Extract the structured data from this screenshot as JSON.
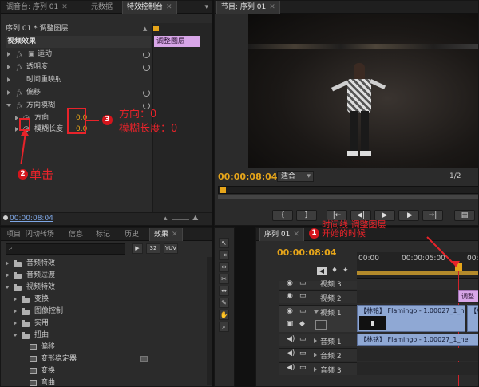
{
  "left_top_panel": {
    "tabs": [
      "调音台: 序列 01",
      "元数据",
      "特效控制台"
    ],
    "sequence_label": "序列 01 * 调整图层",
    "section": "视频效果",
    "effects": [
      "运动",
      "透明度",
      "时间重映射",
      "偏移",
      "方向模糊"
    ],
    "params": [
      {
        "label": "方向",
        "value": "0.0"
      },
      {
        "label": "模糊长度",
        "value": "0.0"
      }
    ],
    "clip_label": "调整图层",
    "timecode": "00:00:08:04"
  },
  "program_monitor": {
    "tab": "节目: 序列 01",
    "timecode": "00:00:08:04",
    "fit": "适合",
    "page": "1/2",
    "buttons": [
      "{",
      "}",
      "|←",
      "◀|",
      "▶",
      "|▶",
      "→|"
    ]
  },
  "project_panel": {
    "tabs": [
      "项目: 闪动转场",
      "信息",
      "标记",
      "历史",
      "效果"
    ],
    "chips": [
      "32",
      "YUV"
    ],
    "tree": [
      {
        "label": "音频特效",
        "level": 0,
        "open": false
      },
      {
        "label": "音频过渡",
        "level": 0,
        "open": false
      },
      {
        "label": "视频特效",
        "level": 0,
        "open": true
      },
      {
        "label": "变换",
        "level": 1,
        "open": false
      },
      {
        "label": "图像控制",
        "level": 1,
        "open": false
      },
      {
        "label": "实用",
        "level": 1,
        "open": false
      },
      {
        "label": "扭曲",
        "level": 1,
        "open": true
      },
      {
        "label": "偏移",
        "level": 2
      },
      {
        "label": "变形稳定器",
        "level": 2
      },
      {
        "label": "变换",
        "level": 2
      },
      {
        "label": "弯曲",
        "level": 2
      }
    ]
  },
  "timeline": {
    "tab": "序列 01",
    "timecode": "00:00:08:04",
    "ruler": [
      "00:00",
      "00:00:05:00",
      "00:"
    ],
    "tracks": [
      "视频 3",
      "视频 2",
      "视频 1",
      "音频 1",
      "音频 2",
      "音频 3"
    ],
    "clip_adjust": "调整",
    "clip_video": "【林铭】 Flamingo - 1.00027_1_ne",
    "clip_video_short": "【林铭】",
    "clip_audio": "【林铭】 Flamingo - 1.00027_1_ne"
  },
  "annotations": {
    "a1": "1",
    "a1_text_line1": "时间线",
    "a1_text_line2": "调整图层",
    "a1_text_line3": "开始的时候",
    "a2": "2",
    "a2_text": "单击",
    "a3": "3",
    "a3_text_line1": "方向：0",
    "a3_text_line2": "模糊长度：0"
  },
  "colors": {
    "accent_orange": "#e6a51a",
    "annotation_red": "#e8232a",
    "clip_blue": "#8fa8d4",
    "clip_pink": "#d8a6e8"
  }
}
